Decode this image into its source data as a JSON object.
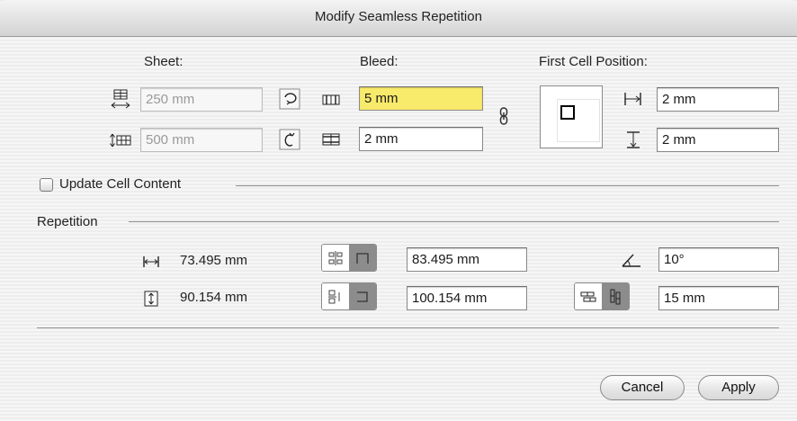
{
  "window": {
    "title": "Modify Seamless Repetition"
  },
  "sheet": {
    "label": "Sheet:",
    "width_value": "250 mm",
    "height_value": "500 mm"
  },
  "bleed": {
    "label": "Bleed:",
    "horizontal_value": "5 mm",
    "vertical_value": "2 mm"
  },
  "first_cell": {
    "label": "First Cell Position:",
    "horizontal_value": "2 mm",
    "vertical_value": "2 mm"
  },
  "update_cell": {
    "label": "Update Cell Content",
    "checked": false
  },
  "repetition": {
    "label": "Repetition",
    "width_value": "73.495 mm",
    "height_value": "90.154 mm",
    "h_spacing_value": "83.495 mm",
    "v_spacing_value": "100.154 mm",
    "angle_value": "10°",
    "offset_value": "15 mm"
  },
  "buttons": {
    "cancel": "Cancel",
    "apply": "Apply"
  },
  "colors": {
    "highlight": "#f8ea6a",
    "segment_active": "#8c8c8c"
  }
}
